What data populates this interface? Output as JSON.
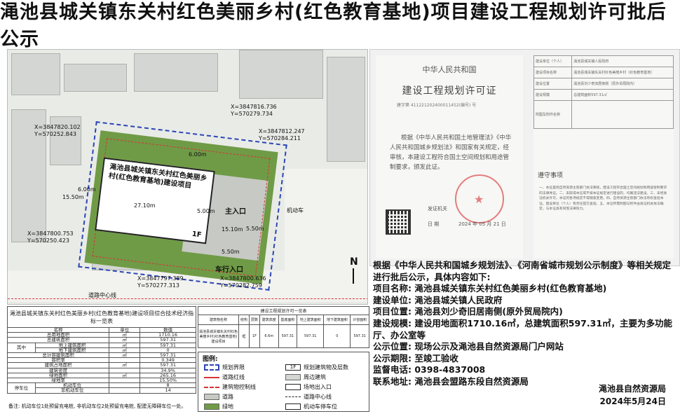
{
  "title": "渑池县城关镇东关村红色美丽乡村(红色教育基地)项目建设工程规划许可批后公示",
  "plan": {
    "building_name": "渑池县城关镇东关村红色美丽乡村(红色教育基地)建设项目",
    "floor": "1F",
    "main_entrance": "主入口",
    "car_entrance": "车行入口",
    "motor_parking": "机动车",
    "label_road": "道路中心线",
    "north": "N",
    "dims": [
      "27.10m",
      "5.00m",
      "15.50m",
      "5.50m",
      "5.50m",
      "6.00m",
      "15.10m",
      "6.00m"
    ],
    "coords": [
      {
        "x": "X=3847820.102",
        "y": "Y=570252.843"
      },
      {
        "x": "X=3847816.736",
        "y": "Y=570279.734"
      },
      {
        "x": "X=3847812.247",
        "y": "Y=570284.211"
      },
      {
        "x": "X=3847800.753",
        "y": "Y=570250.423"
      },
      {
        "x": "X=3847797.389",
        "y": "Y=570277.313"
      },
      {
        "x": "X=3847800.636",
        "y": "Y=570282.759"
      }
    ]
  },
  "license": {
    "country": "中华人民共和国",
    "name": "建设工程规划许可证",
    "number": "建字第 411221202400011452(编号) 号",
    "body": "根据《中华人民共和国土地管理法》《中华人民共和国城乡规划法》和国家有关规定，经审核，本建设工程符合国土空间规划和用途管制要求，颁发此证。",
    "issuer": "发证机关",
    "date_label": "日 期",
    "date": "2024 年 05 月 21 日",
    "notice_title": "遵守事项",
    "notice": "一、本证是经自然资源主管部门依法审核，建设工程符合国土空间规划和用途管制要求的法律凭证。二、未取得本证或不按本证规定进行建设的，均属违法建设。三、未经发证机关许可，本证的各项规定不得随意变更。四、自然资源主管部门依法有权查验本证，建设单位（个人）有责任提交查验。五、本证所需附图与附件由发证机关依法确定，与本证具有同等法律效力。",
    "rows": [
      "建设单位（个人）",
      "建设项目名称",
      "建设位置",
      "建设规模",
      "附图及附件名称"
    ],
    "row_values": [
      "渑池县城关镇人民政府",
      "渑池县城关镇东关村红色美丽乡村（红色教育基地）",
      "渑池县刘少奇旧居南侧（原外贸局院内）",
      "总建筑面积597.31㎡",
      ""
    ]
  },
  "tech_table": {
    "caption": "渑池县城关镇东关村红色美丽乡村(红色教育基地)建设项目综合技术经济指标一览表",
    "headers": [
      "名称",
      "单位",
      "数值"
    ],
    "rows": [
      {
        "name": "总用地面积",
        "unit": "㎡",
        "value": "1710.16"
      },
      {
        "name": "总建筑面积",
        "unit": "㎡",
        "value": "597.31"
      },
      {
        "name": "地上建筑面积",
        "unit": "㎡",
        "value": "597.31"
      },
      {
        "name": "地下建筑面积",
        "unit": "㎡",
        "value": "0"
      },
      {
        "name": "总计容建筑面积",
        "unit": "㎡",
        "value": "597.31"
      },
      {
        "name": "容积率",
        "unit": "",
        "value": "0.349"
      },
      {
        "name": "建筑占地面积",
        "unit": "㎡",
        "value": "597.31"
      },
      {
        "name": "建筑密度",
        "unit": "",
        "value": "34.9%"
      },
      {
        "name": "绿地面积",
        "unit": "㎡",
        "value": "265.16"
      },
      {
        "name": "绿地率",
        "unit": "",
        "value": "15.50%"
      },
      {
        "name": "机动车位",
        "unit": "",
        "value": "8"
      },
      {
        "name": "非机动车位",
        "unit": "",
        "value": "14"
      }
    ],
    "group_label": "其中",
    "parking_label": "停车位",
    "note": "备注: 机动车位1处预留充电桩, 非机动车位2处预留充电桩, 配建无障碍车位一处。"
  },
  "build_list": {
    "caption": "建设工程规划许可一览表",
    "headers": [
      "建筑物名称",
      "结构",
      "层数",
      "建筑高度",
      "基底面积",
      "地上建筑面积",
      "地下建筑面积",
      "计容面积"
    ],
    "row": [
      "渑池县城关镇东关村红色美丽乡村(红色教育基地)建设项目",
      "框",
      "1F",
      "6.6m",
      "597.31",
      "597.31",
      "0",
      "597.31"
    ]
  },
  "legend": {
    "title": "图例:",
    "items": [
      "规划界限",
      "道路红线",
      "建筑物控制线",
      "道路",
      "绿地",
      "规划建筑物及层数",
      "周边建筑",
      "场地出入口",
      "道路中心线",
      "机动车停车位"
    ]
  },
  "announcement": {
    "intro": "根据《中华人民共和国城乡规划法》、《河南省城市规划公示制度》等相关规定进行批后公示，具体内容如下:",
    "project": "项目名称: 渑池县城关镇东关村红色美丽乡村(红色教育基地)",
    "unit": "建设单位: 渑池县城关镇人民政府",
    "location": "项目位置: 渑池县刘少奇旧居南侧(原外贸局院内)",
    "scale": "建设规模: 建设用地面积1710.16㎡，总建筑面积597.31㎡，主要为多功能厅、办公室等",
    "place": "公示位置: 现场公示及渑池县自然资源局门户网站",
    "period": "公示期限: 至竣工验收",
    "phone": "监督电话: 0398-4837008",
    "address": "联系地址: 渑池县会盟路东段自然资源局",
    "signer": "渑池县自然资源局",
    "date": "2024年5月24日"
  }
}
